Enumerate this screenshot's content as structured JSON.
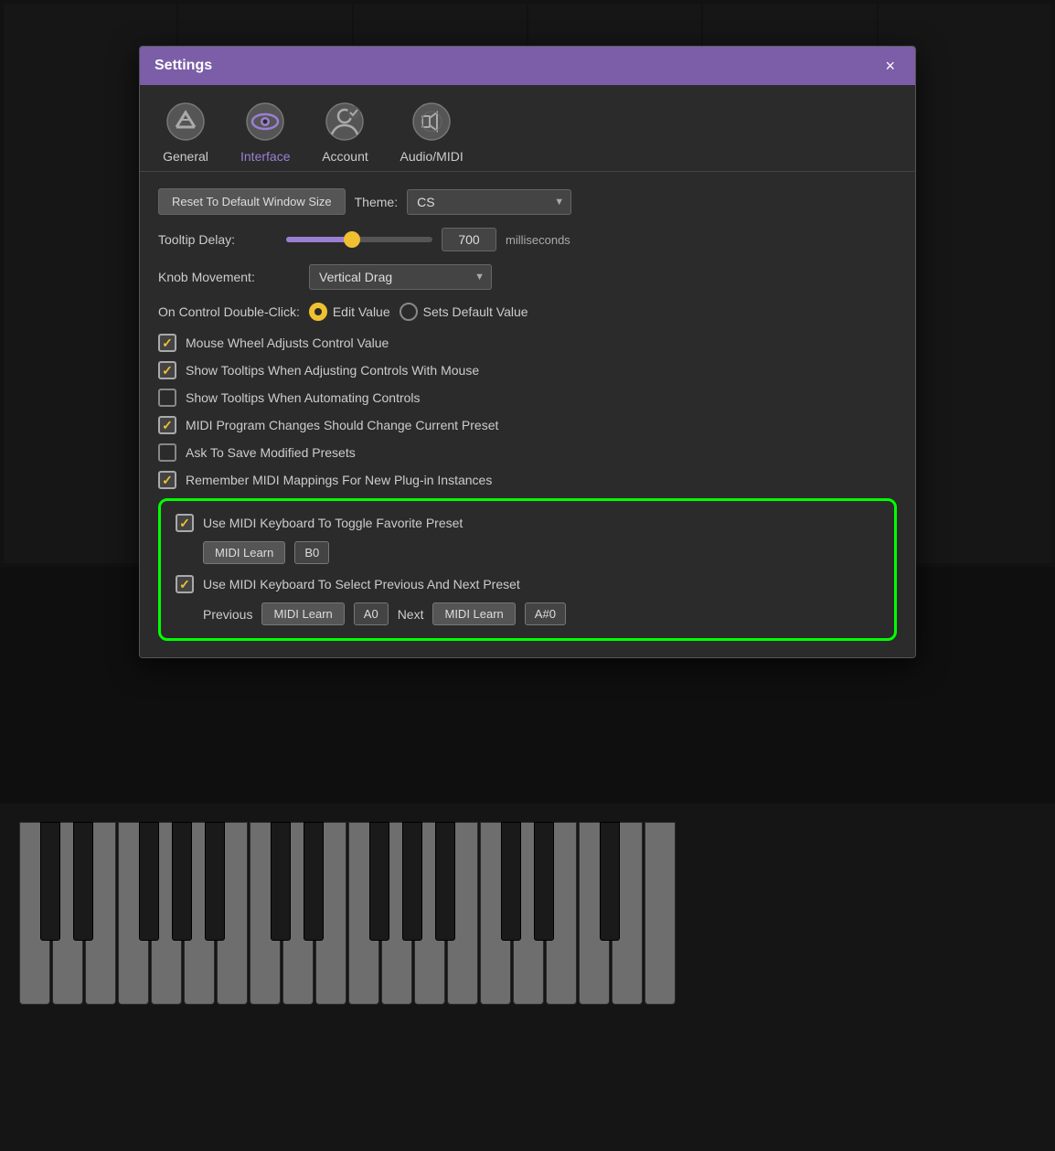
{
  "window": {
    "title": "Settings",
    "close_label": "×"
  },
  "tabs": [
    {
      "id": "general",
      "label": "General",
      "active": false
    },
    {
      "id": "interface",
      "label": "Interface",
      "active": true
    },
    {
      "id": "account",
      "label": "Account",
      "active": false
    },
    {
      "id": "audiomidi",
      "label": "Audio/MIDI",
      "active": false
    }
  ],
  "interface": {
    "reset_button": "Reset To Default Window Size",
    "theme_label": "Theme:",
    "theme_value": "CS",
    "tooltip_delay_label": "Tooltip Delay:",
    "tooltip_delay_value": "700",
    "tooltip_delay_unit": "milliseconds",
    "tooltip_slider_pct": 45,
    "knob_movement_label": "Knob Movement:",
    "knob_movement_value": "Vertical Drag",
    "double_click_label": "On Control Double-Click:",
    "double_click_edit": "Edit Value",
    "double_click_default": "Sets Default Value",
    "checkboxes": [
      {
        "id": "mouse_wheel",
        "label": "Mouse Wheel Adjusts Control Value",
        "checked": true
      },
      {
        "id": "show_tooltips_mouse",
        "label": "Show Tooltips When Adjusting Controls With Mouse",
        "checked": true
      },
      {
        "id": "show_tooltips_auto",
        "label": "Show Tooltips When Automating Controls",
        "checked": false
      },
      {
        "id": "midi_program",
        "label": "MIDI Program Changes Should Change Current Preset",
        "checked": true
      },
      {
        "id": "ask_save",
        "label": "Ask To Save Modified Presets",
        "checked": false
      },
      {
        "id": "remember_midi",
        "label": "Remember MIDI Mappings For New Plug-in Instances",
        "checked": true
      }
    ],
    "green_section": {
      "toggle_favorite": {
        "checkbox_label": "Use MIDI Keyboard To Toggle Favorite Preset",
        "checked": true,
        "midi_learn_label": "MIDI Learn",
        "note_value": "B0"
      },
      "select_preset": {
        "checkbox_label": "Use MIDI Keyboard To Select Previous And Next Preset",
        "checked": true,
        "previous_label": "Previous",
        "previous_midi_learn": "MIDI Learn",
        "previous_note": "A0",
        "next_label": "Next",
        "next_midi_learn": "MIDI Learn",
        "next_note": "A#0"
      }
    }
  }
}
